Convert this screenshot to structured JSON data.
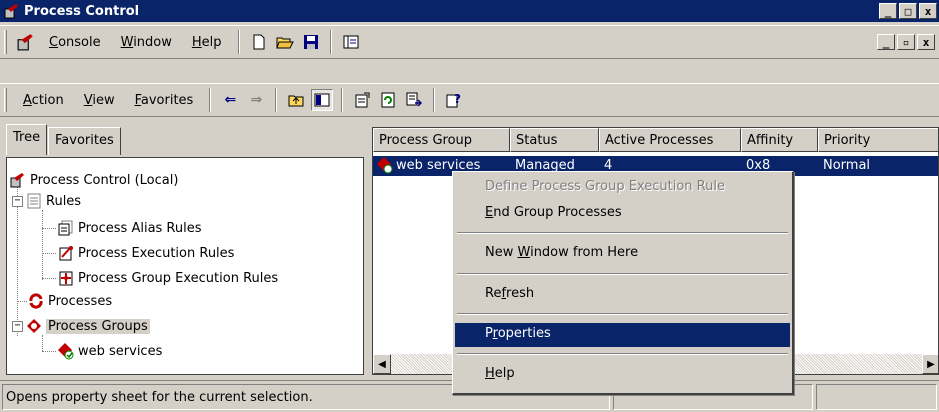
{
  "window": {
    "title": "Process Control"
  },
  "caption_buttons": {
    "minimize": "_",
    "maximize": "□",
    "close": "x"
  },
  "inner_buttons": {
    "minimize": "_",
    "restore": "▫",
    "close": "x"
  },
  "menubar": [
    {
      "pre": "",
      "u": "C",
      "post": "onsole"
    },
    {
      "pre": "",
      "u": "W",
      "post": "indow"
    },
    {
      "pre": "",
      "u": "H",
      "post": "elp"
    }
  ],
  "actionbar": [
    {
      "pre": "",
      "u": "A",
      "post": "ction"
    },
    {
      "pre": "",
      "u": "V",
      "post": "iew"
    },
    {
      "pre": "",
      "u": "F",
      "post": "avorites"
    }
  ],
  "tabs": {
    "tree": "Tree",
    "favorites": "Favorites"
  },
  "tree": {
    "root": "Process Control (Local)",
    "rules": "Rules",
    "alias_rules": "Process Alias Rules",
    "exec_rules": "Process Execution Rules",
    "group_exec_rules": "Process Group Execution Rules",
    "processes": "Processes",
    "process_groups": "Process Groups",
    "web_services": "web services"
  },
  "list": {
    "columns": [
      "Process Group",
      "Status",
      "Active Processes",
      "Affinity",
      "Priority"
    ],
    "rows": [
      {
        "group": "web services",
        "status": "Managed",
        "active": "4",
        "affinity": "0x8",
        "priority": "Normal"
      }
    ]
  },
  "context_menu": {
    "define_rule": "Define Process Group Execution Rule",
    "end_group": {
      "pre": "",
      "u": "E",
      "post": "nd Group Processes"
    },
    "new_window": {
      "pre": "New ",
      "u": "W",
      "post": "indow from Here"
    },
    "refresh": {
      "pre": "Re",
      "u": "f",
      "post": "resh"
    },
    "properties": {
      "pre": "P",
      "u": "r",
      "post": "operties"
    },
    "help": {
      "pre": "",
      "u": "H",
      "post": "elp"
    }
  },
  "statusbar": {
    "text": "Opens property sheet for the current selection."
  },
  "colors": {
    "title_bg": "#0a246a",
    "face": "#d4d0c8",
    "highlight": "#0a246a"
  }
}
